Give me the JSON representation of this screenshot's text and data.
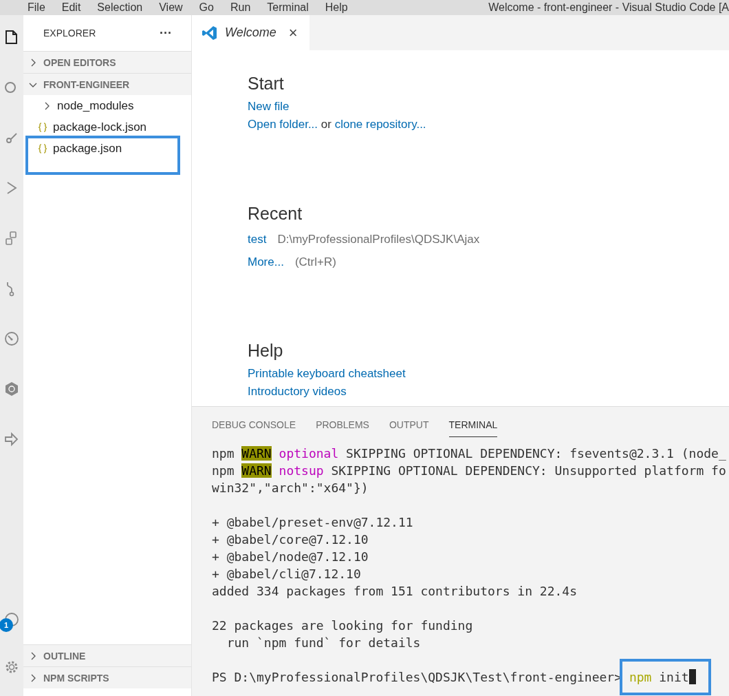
{
  "menu": [
    "File",
    "Edit",
    "Selection",
    "View",
    "Go",
    "Run",
    "Terminal",
    "Help"
  ],
  "window": {
    "title": "Welcome - front-engineer - Visual Studio Code [A"
  },
  "activity_bar": {
    "badge": "1"
  },
  "sidebar": {
    "title": "EXPLORER",
    "more": "···",
    "sections": [
      {
        "label": "OPEN EDITORS",
        "expanded": false
      },
      {
        "label": "FRONT-ENGINEER",
        "expanded": true,
        "items": [
          {
            "name": "node_modules",
            "kind": "folder",
            "expanded": false,
            "highlighted": false
          },
          {
            "name": "package-lock.json",
            "kind": "json",
            "highlighted": false
          },
          {
            "name": "package.json",
            "kind": "json",
            "highlighted": true
          }
        ]
      }
    ],
    "bottom_sections": [
      {
        "label": "OUTLINE",
        "expanded": false
      },
      {
        "label": "NPM SCRIPTS",
        "expanded": false
      }
    ]
  },
  "tabs": [
    {
      "label": "Welcome",
      "selected": true,
      "close": "×"
    }
  ],
  "welcome": {
    "start": {
      "title": "Start",
      "new_file": "New file",
      "open_folder": "Open folder...",
      "or": "or",
      "clone": "clone repository..."
    },
    "recent": {
      "title": "Recent",
      "items": [
        {
          "name": "test",
          "path": "D:\\myProfessionalProfiles\\QDSJK\\Ajax"
        }
      ],
      "more": "More...",
      "shortcut": "(Ctrl+R)"
    },
    "help": {
      "title": "Help",
      "links": [
        "Printable keyboard cheatsheet",
        "Introductory videos"
      ]
    }
  },
  "panel": {
    "tabs": [
      {
        "label": "DEBUG CONSOLE",
        "selected": false
      },
      {
        "label": "PROBLEMS",
        "selected": false
      },
      {
        "label": "OUTPUT",
        "selected": false
      },
      {
        "label": "TERMINAL",
        "selected": true
      }
    ],
    "lines": [
      {
        "kind": "output",
        "segments": [
          {
            "kind": "plain",
            "text": "npm "
          },
          {
            "kind": "warn",
            "text": "WARN"
          },
          {
            "kind": "keyword",
            "text": " optional"
          },
          {
            "kind": "plain",
            "text": " SKIPPING OPTIONAL DEPENDENCY: fsevents@2.3.1 (node_"
          }
        ]
      },
      {
        "kind": "output",
        "segments": [
          {
            "kind": "plain",
            "text": "npm "
          },
          {
            "kind": "warn",
            "text": "WARN"
          },
          {
            "kind": "keyword",
            "text": " notsup"
          },
          {
            "kind": "plain",
            "text": " SKIPPING OPTIONAL DEPENDENCY: Unsupported platform fo"
          }
        ]
      },
      {
        "kind": "output",
        "segments": [
          {
            "kind": "plain",
            "text": "win32\",\"arch\":\"x64\"})"
          }
        ]
      },
      {
        "kind": "blank"
      },
      {
        "kind": "output",
        "segments": [
          {
            "kind": "plain",
            "text": "+ @babel/preset-env@7.12.11"
          }
        ]
      },
      {
        "kind": "output",
        "segments": [
          {
            "kind": "plain",
            "text": "+ @babel/core@7.12.10"
          }
        ]
      },
      {
        "kind": "output",
        "segments": [
          {
            "kind": "plain",
            "text": "+ @babel/node@7.12.10"
          }
        ]
      },
      {
        "kind": "output",
        "segments": [
          {
            "kind": "plain",
            "text": "+ @babel/cli@7.12.10"
          }
        ]
      },
      {
        "kind": "output",
        "segments": [
          {
            "kind": "plain",
            "text": "added 334 packages from 151 contributors in 22.4s"
          }
        ]
      },
      {
        "kind": "blank"
      },
      {
        "kind": "output",
        "segments": [
          {
            "kind": "plain",
            "text": "22 packages are looking for funding"
          }
        ]
      },
      {
        "kind": "output",
        "segments": [
          {
            "kind": "plain",
            "text": "  run `npm fund` for details"
          }
        ]
      },
      {
        "kind": "blank"
      },
      {
        "kind": "prompt",
        "text": "PS D:\\myProfessionalProfiles\\QDSJK\\Test\\front-engineer>",
        "command": "npm",
        "argument": "init",
        "highlighted": true,
        "cursor": true
      }
    ]
  }
}
